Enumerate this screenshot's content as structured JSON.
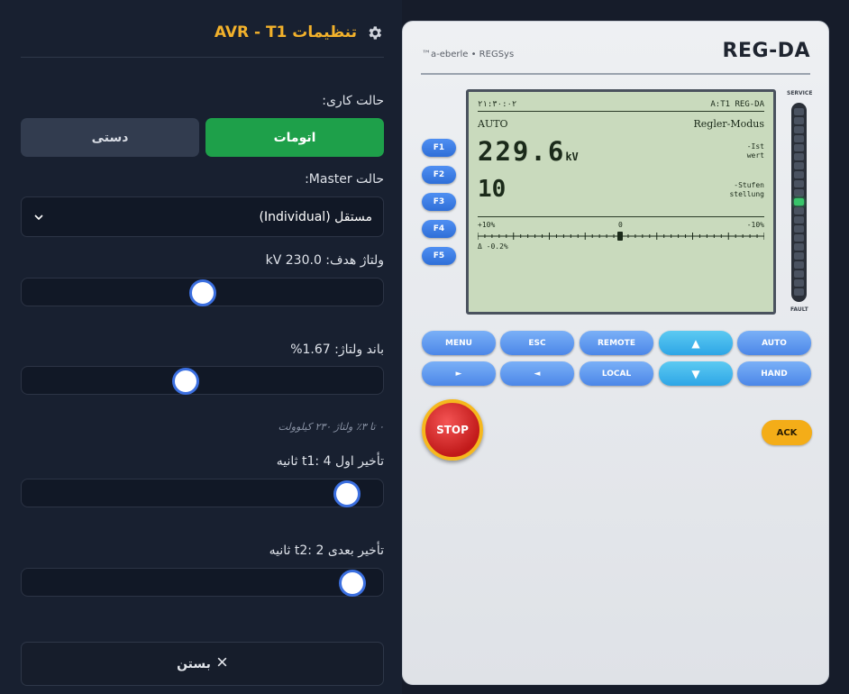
{
  "settings": {
    "title": "تنظیمات AVR - T1",
    "mode_label": "حالت کاری:",
    "mode_manual": "دستی",
    "mode_auto": "اتومات",
    "master_label": "حالت Master:",
    "master_value": "مستقل (Individual)",
    "target_label": "ولتاژ هدف: 230.0 kV",
    "target_value": 230.0,
    "band_label": "باند ولتاژ: 1.67%",
    "band_value": 1.67,
    "band_hint": "۰ تا ۳٪ ولتاژ ۲۳۰ کیلوولت",
    "t1_label": "تأخیر اول t1: 4 ثانیه",
    "t1_value": 4,
    "t2_label": "تأخیر بعدی t2: 2 ثانیه",
    "t2_value": 2,
    "close_label": "بستن",
    "accent": "#f2b12b",
    "active_color": "#1ea04a"
  },
  "device": {
    "brand": "™a-eberle • REGSys",
    "model": "REG-DA",
    "fkeys": [
      "F1",
      "F2",
      "F3",
      "F4",
      "F5"
    ],
    "lcd": {
      "time": "۲۱:۳۰:۰۲",
      "device_id": "A:T1 REG-DA",
      "mode": "AUTO",
      "mode_caption": "Regler-Modus",
      "voltage": "229.6",
      "voltage_unit": "kV",
      "ist_line1": "-Ist",
      "ist_line2": "wert",
      "tap": "10",
      "stufen_line1": "-Stufen",
      "stufen_line2": "stellung",
      "scale_left": "+10%",
      "scale_center": "0",
      "scale_right": "-10%",
      "delta": "Δ -0.2%"
    },
    "service_label": "SERVICE",
    "fault_label": "FAULT",
    "led_level": 0.5,
    "keys_row1": [
      "MENU",
      "ESC",
      "REMOTE",
      "▲",
      "AUTO"
    ],
    "keys_row2": [
      "►",
      "◄",
      "LOCAL",
      "▼",
      "HAND"
    ],
    "stop_label": "STOP",
    "ack_label": "ACK"
  }
}
